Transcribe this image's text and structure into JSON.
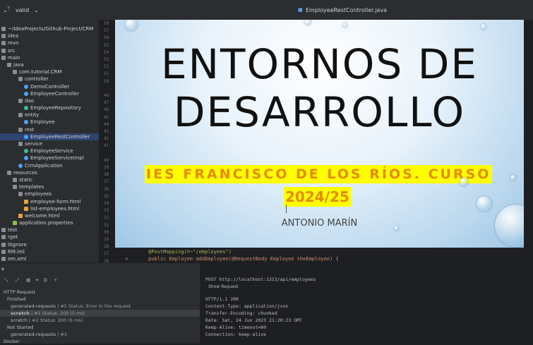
{
  "topbar": {
    "branch": "valid",
    "file_tab": "EmployeeRestController.java"
  },
  "project_tree": [
    {
      "label": "~/IdeaProjects/Github-Project/CRM",
      "indent": 0,
      "icon": "folder"
    },
    {
      "label": "idea",
      "indent": 0,
      "icon": "folder"
    },
    {
      "label": "mvn",
      "indent": 0,
      "icon": "folder"
    },
    {
      "label": "src",
      "indent": 0,
      "icon": "folder"
    },
    {
      "label": "main",
      "indent": 0,
      "icon": "folder"
    },
    {
      "label": "java",
      "indent": 1,
      "icon": "folder"
    },
    {
      "label": "com.tutorial.CRM",
      "indent": 2,
      "icon": "package"
    },
    {
      "label": "controller",
      "indent": 3,
      "icon": "package"
    },
    {
      "label": "DemoController",
      "indent": 4,
      "icon": "class"
    },
    {
      "label": "EmployeeController",
      "indent": 4,
      "icon": "class"
    },
    {
      "label": "dao",
      "indent": 3,
      "icon": "package"
    },
    {
      "label": "EmployeeRepository",
      "indent": 4,
      "icon": "interface"
    },
    {
      "label": "entity",
      "indent": 3,
      "icon": "package"
    },
    {
      "label": "Employee",
      "indent": 4,
      "icon": "class"
    },
    {
      "label": "rest",
      "indent": 3,
      "icon": "package"
    },
    {
      "label": "EmployeeRestController",
      "indent": 4,
      "icon": "class",
      "selected": true
    },
    {
      "label": "service",
      "indent": 3,
      "icon": "package"
    },
    {
      "label": "EmployeeService",
      "indent": 4,
      "icon": "interface"
    },
    {
      "label": "EmployeeServiceImpl",
      "indent": 4,
      "icon": "class"
    },
    {
      "label": "CrmApplication",
      "indent": 3,
      "icon": "class"
    },
    {
      "label": "resources",
      "indent": 1,
      "icon": "folder"
    },
    {
      "label": "static",
      "indent": 2,
      "icon": "folder"
    },
    {
      "label": "templates",
      "indent": 2,
      "icon": "folder"
    },
    {
      "label": "employees",
      "indent": 3,
      "icon": "folder"
    },
    {
      "label": "employee-form.html",
      "indent": 4,
      "icon": "html"
    },
    {
      "label": "list-employees.html",
      "indent": 4,
      "icon": "html"
    },
    {
      "label": "welcome.html",
      "indent": 3,
      "icon": "html"
    },
    {
      "label": "application.properties",
      "indent": 2,
      "icon": "props"
    },
    {
      "label": "test",
      "indent": 0,
      "icon": "folder"
    },
    {
      "label": "rget",
      "indent": 0,
      "icon": "folder"
    },
    {
      "label": "itignore",
      "indent": 0,
      "icon": "file"
    },
    {
      "label": "RM.iml",
      "indent": 0,
      "icon": "file"
    },
    {
      "label": "om.xml",
      "indent": 0,
      "icon": "file"
    }
  ],
  "line_numbers": [
    "58",
    "57",
    "56",
    "55",
    "54",
    "53",
    "52",
    "51",
    "50",
    "",
    "48",
    "47",
    "46",
    "45",
    "44",
    "43",
    "42",
    "41",
    "",
    "40",
    "39",
    "38",
    "37",
    "36",
    "35",
    "34",
    "33",
    "32",
    "31",
    "30",
    "29",
    "28",
    "27",
    "26"
  ],
  "code": {
    "line27": "@PostMapping(©~\"/employees\")",
    "line26": "public Employee addEmployee(@RequestBody Employee theEmployee) {"
  },
  "slide": {
    "title_line1": "ENTORNOS DE",
    "title_line2": "DESARROLLO",
    "subtitle_line1": "IES FRANCISCO DE LOS RÍOS. CURSO",
    "subtitle_line2": "2024/25",
    "author": "ANTONIO MARÍN"
  },
  "services": {
    "header": "s",
    "items": [
      {
        "label": "HTTP Request",
        "detail": ""
      },
      {
        "label": "Finished",
        "detail": ""
      },
      {
        "label": "generated-requests",
        "detail": "| #5 Status: Error in the request"
      },
      {
        "label": "scratch",
        "detail": "| #1 Status: 200 (5 ms)",
        "selected": true
      },
      {
        "label": "scratch",
        "detail": "| #2 Status: 200 (6 ms)"
      },
      {
        "label": "Not Started",
        "detail": ""
      },
      {
        "label": "generated-requests",
        "detail": "| #3"
      },
      {
        "label": "Docker",
        "detail": ""
      }
    ]
  },
  "response": {
    "request_line": "POST http://localhost:1313/api/employees",
    "show_request": "Show Request",
    "lines": [
      "HTTP/1.1 200",
      "Content-Type: application/json",
      "Transfer-Encoding: chunked",
      "Date: Sat, 24 Jun 2023 21:20:23 GMT",
      "Keep-Alive: timeout=60",
      "Connection: keep-alive"
    ]
  },
  "colors": {
    "subtitle_bg": "#ffff00",
    "subtitle_fg": "#e68a00",
    "selected_row": "#2e436e"
  }
}
